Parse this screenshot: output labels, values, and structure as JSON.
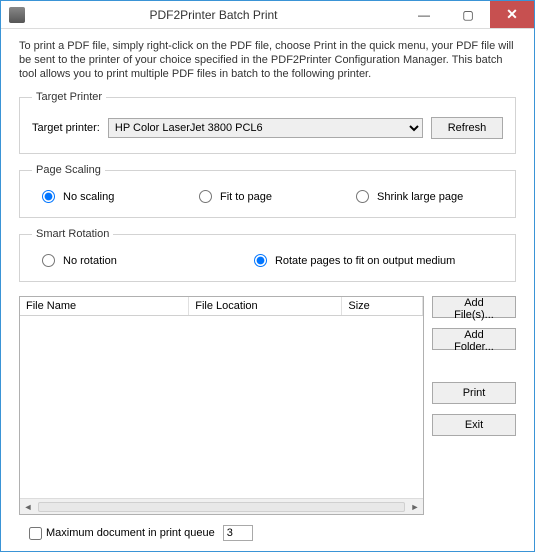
{
  "window": {
    "title": "PDF2Printer Batch Print"
  },
  "description": "To print a PDF file, simply right-click on the PDF file, choose Print in the quick menu, your PDF file will be sent to the printer of your choice specified in the PDF2Printer Configuration Manager. This batch tool allows you to print multiple PDF files in batch to the following printer.",
  "targetPrinter": {
    "legend": "Target Printer",
    "label": "Target printer:",
    "selected": "HP Color LaserJet 3800 PCL6",
    "refresh": "Refresh"
  },
  "pageScaling": {
    "legend": "Page Scaling",
    "noScaling": "No scaling",
    "fitToPage": "Fit to page",
    "shrinkLarge": "Shrink large page",
    "selected": "noScaling"
  },
  "smartRotation": {
    "legend": "Smart Rotation",
    "noRotation": "No rotation",
    "rotateFit": "Rotate pages to fit on output medium",
    "selected": "rotateFit"
  },
  "fileList": {
    "columns": {
      "name": "File Name",
      "location": "File Location",
      "size": "Size"
    },
    "rows": []
  },
  "buttons": {
    "addFiles": "Add File(s)...",
    "addFolder": "Add Folder...",
    "print": "Print",
    "exit": "Exit"
  },
  "footer": {
    "maxQueueLabel": "Maximum document in print queue",
    "maxQueueValue": "3",
    "maxQueueChecked": false
  }
}
